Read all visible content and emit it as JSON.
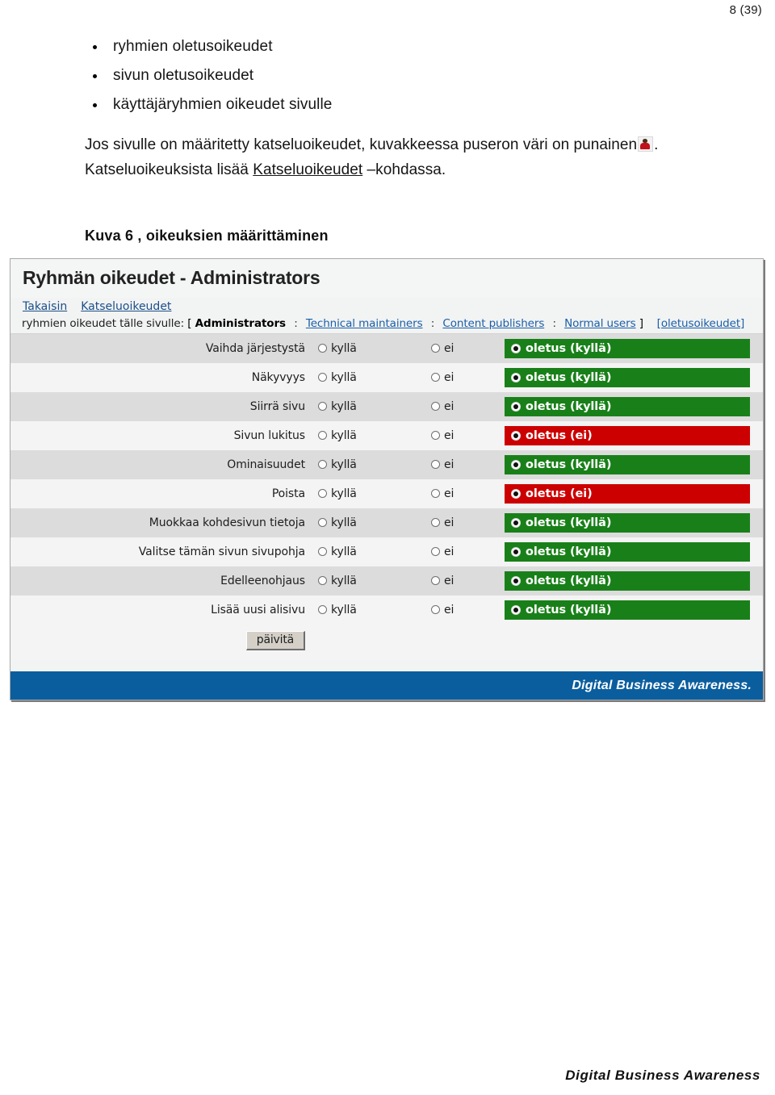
{
  "page": {
    "number_label": "8 (39)",
    "footer_brand": "Digital Business Awareness"
  },
  "document": {
    "bullets": [
      "ryhmien oletusoikeudet",
      "sivun oletusoikeudet",
      "käyttäjäryhmien oikeudet sivulle"
    ],
    "paragraph_part1": "Jos sivulle on määritetty katseluoikeudet, kuvakkeessa puseron väri on punainen",
    "paragraph_part2": ".",
    "paragraph_line2_pre": "Katseluoikeuksista lisää ",
    "paragraph_line2_link": "Katseluoikeudet",
    "paragraph_line2_post": " –kohdassa.",
    "icon_name": "red-shirt-person-icon",
    "caption": "Kuva 6 , oikeuksien määrittäminen"
  },
  "screenshot": {
    "title": "Ryhmän oikeudet - Administrators",
    "nav_links": [
      "Takaisin",
      "Katseluoikeudet"
    ],
    "breadcrumb": {
      "prefix": "ryhmien oikeudet tälle sivulle:",
      "open_bracket": "[",
      "current_group": "Administrators",
      "separator": ":",
      "other_groups": [
        "Technical maintainers",
        "Content publishers",
        "Normal users"
      ],
      "close_bracket": "]",
      "defaults_link": "[oletusoikeudet]"
    },
    "columns": {
      "yes_label": "kyllä",
      "no_label": "ei"
    },
    "rows": [
      {
        "label": "Vaihda järjestystä",
        "yes": "kyllä",
        "no": "ei",
        "default_label": "oletus (kyllä)",
        "default_state": "yes"
      },
      {
        "label": "Näkyvyys",
        "yes": "kyllä",
        "no": "ei",
        "default_label": "oletus (kyllä)",
        "default_state": "yes"
      },
      {
        "label": "Siirrä sivu",
        "yes": "kyllä",
        "no": "ei",
        "default_label": "oletus (kyllä)",
        "default_state": "yes"
      },
      {
        "label": "Sivun lukitus",
        "yes": "kyllä",
        "no": "ei",
        "default_label": "oletus (ei)",
        "default_state": "no"
      },
      {
        "label": "Ominaisuudet",
        "yes": "kyllä",
        "no": "ei",
        "default_label": "oletus (kyllä)",
        "default_state": "yes"
      },
      {
        "label": "Poista",
        "yes": "kyllä",
        "no": "ei",
        "default_label": "oletus (ei)",
        "default_state": "no"
      },
      {
        "label": "Muokkaa kohdesivun tietoja",
        "yes": "kyllä",
        "no": "ei",
        "default_label": "oletus (kyllä)",
        "default_state": "yes"
      },
      {
        "label": "Valitse tämän sivun sivupohja",
        "yes": "kyllä",
        "no": "ei",
        "default_label": "oletus (kyllä)",
        "default_state": "yes"
      },
      {
        "label": "Edelleenohjaus",
        "yes": "kyllä",
        "no": "ei",
        "default_label": "oletus (kyllä)",
        "default_state": "yes"
      },
      {
        "label": "Lisää uusi alisivu",
        "yes": "kyllä",
        "no": "ei",
        "default_label": "oletus (kyllä)",
        "default_state": "yes"
      }
    ],
    "submit_label": "päivitä",
    "footer_brand": "Digital Business Awareness.",
    "colors": {
      "default_yes": "#198019",
      "default_no": "#cc0000",
      "footer_blue": "#0b5e9e",
      "link": "#1a5fa8",
      "row_odd": "#dcdcdc",
      "row_even": "#f4f4f4"
    }
  }
}
